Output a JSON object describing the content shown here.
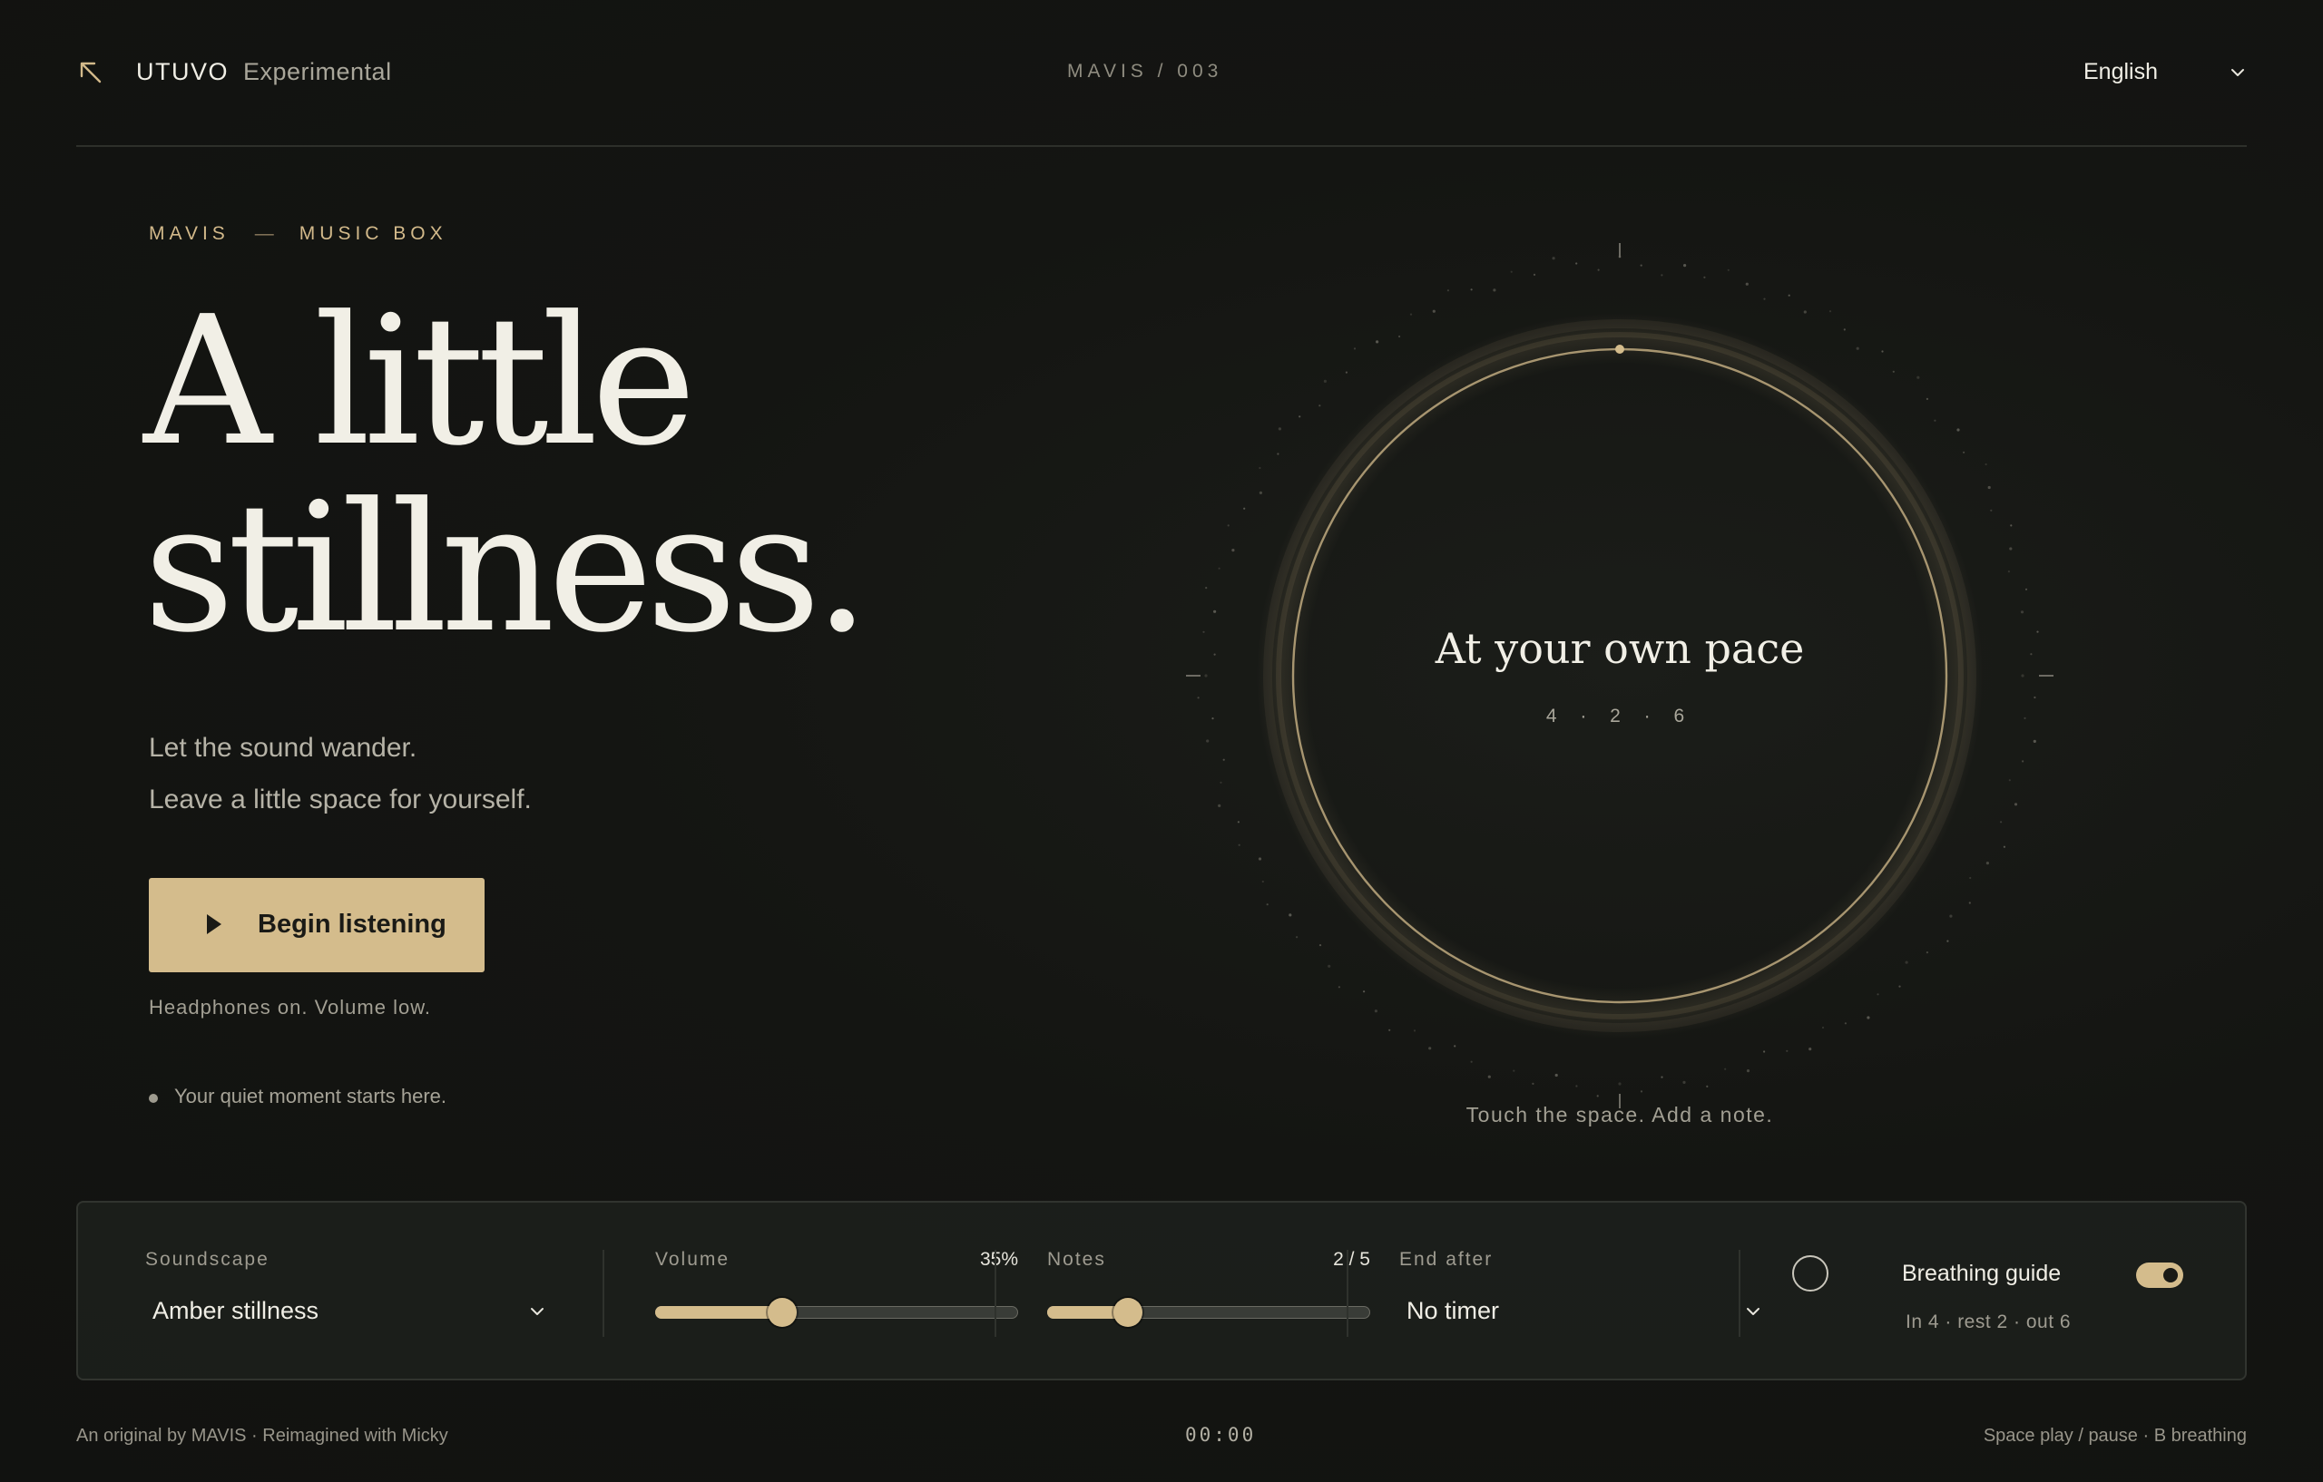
{
  "header": {
    "brand": "UTUVO",
    "brand_sub": "Experimental",
    "episode": "MAVIS / 003",
    "language": "English",
    "back_icon": "arrow-up-left-icon",
    "chevron_icon": "chevron-down-icon"
  },
  "hero": {
    "eyebrow_left": "MAVIS",
    "eyebrow_sep": "—",
    "eyebrow_right": "MUSIC BOX",
    "headline_line1": "A little",
    "headline_line2": "stillness.",
    "lede_line1": "Let the sound wander.",
    "lede_line2": "Leave a little space for yourself.",
    "cta_label": "Begin listening",
    "cta_icon": "play-icon",
    "cta_note": "Headphones on. Volume low.",
    "status_text": "Your quiet moment starts here."
  },
  "orb": {
    "mode": "At your own pace",
    "pattern": "4 · 2 · 6",
    "hint": "Touch the space. Add a note."
  },
  "controls": {
    "soundscape": {
      "label": "Soundscape",
      "value": "Amber stillness"
    },
    "volume": {
      "label": "Volume",
      "value_text": "35%",
      "percent": 35
    },
    "notes": {
      "label": "Notes",
      "value_text": "2 / 5",
      "current": 2,
      "max": 5
    },
    "end_after": {
      "label": "End after",
      "value": "No timer"
    },
    "breathing": {
      "label": "Breathing guide",
      "sub": "In 4 · rest 2 · out 6",
      "enabled": true
    }
  },
  "footer": {
    "credit": "An original by MAVIS · Reimagined with Micky",
    "timer": "00:00",
    "shortcuts": "Space play / pause · B breathing"
  },
  "colors": {
    "background": "#141512",
    "accent": "#d4bc8c",
    "text": "#f1efe6",
    "muted": "#a29f93"
  }
}
